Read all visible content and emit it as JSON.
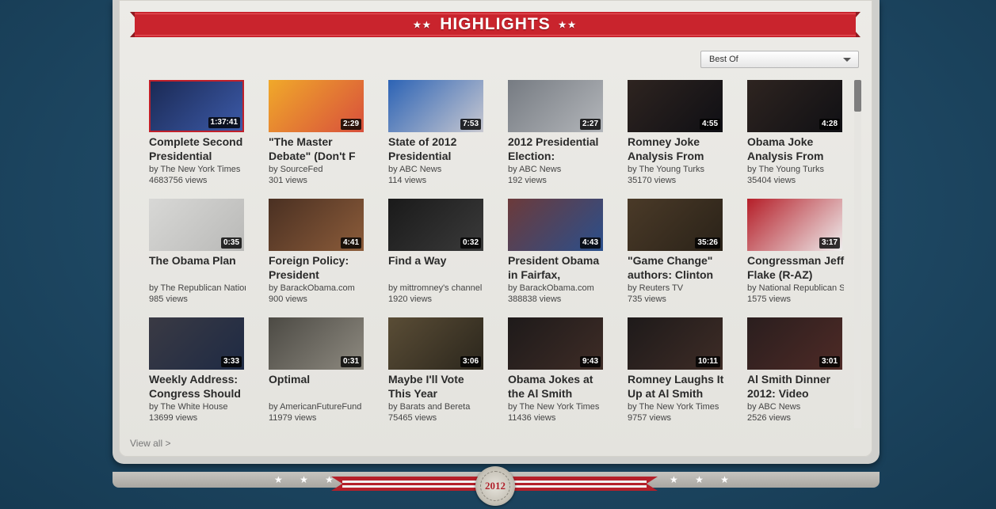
{
  "banner": {
    "title": "HIGHLIGHTS",
    "stars": "★★"
  },
  "filter": {
    "selected": "Best Of"
  },
  "videos": [
    {
      "title": "Complete Second Presidential",
      "duration": "1:37:41",
      "by": "by The New York Times",
      "views": "4683756 views",
      "selected": true
    },
    {
      "title": "\"The Master Debate\" (Don't F",
      "duration": "2:29",
      "by": "by SourceFed",
      "views": "301 views"
    },
    {
      "title": "State of 2012 Presidential",
      "duration": "7:53",
      "by": "by ABC News",
      "views": "114 views"
    },
    {
      "title": "2012 Presidential Election:",
      "duration": "2:27",
      "by": "by ABC News",
      "views": "192 views"
    },
    {
      "title": "Romney Joke Analysis From",
      "duration": "4:55",
      "by": "by The Young Turks",
      "views": "35170 views"
    },
    {
      "title": "Obama Joke Analysis From",
      "duration": "4:28",
      "by": "by The Young Turks",
      "views": "35404 views"
    },
    {
      "title": "The Obama Plan",
      "duration": "0:35",
      "by": "by The Republican Nation",
      "views": "985 views"
    },
    {
      "title": "Foreign Policy: President",
      "duration": "4:41",
      "by": "by BarackObama.com",
      "views": "900 views"
    },
    {
      "title": "Find a Way",
      "duration": "0:32",
      "by": "by mittromney's channel",
      "views": "1920 views"
    },
    {
      "title": "President Obama in Fairfax,",
      "duration": "4:43",
      "by": "by BarackObama.com",
      "views": "388838 views"
    },
    {
      "title": "\"Game Change\" authors: Clinton",
      "duration": "35:26",
      "by": "by Reuters TV",
      "views": "735 views"
    },
    {
      "title": "Congressman Jeff Flake (R-AZ)",
      "duration": "3:17",
      "by": "by National Republican Se",
      "views": "1575 views"
    },
    {
      "title": "Weekly Address: Congress Should",
      "duration": "3:33",
      "by": "by The White House",
      "views": "13699 views"
    },
    {
      "title": "Optimal",
      "duration": "0:31",
      "by": "by AmericanFutureFund",
      "views": "11979 views"
    },
    {
      "title": "Maybe I'll Vote This Year",
      "duration": "3:06",
      "by": "by Barats and Bereta",
      "views": "75465 views"
    },
    {
      "title": "Obama Jokes at the Al Smith",
      "duration": "9:43",
      "by": "by The New York Times",
      "views": "11436 views"
    },
    {
      "title": "Romney Laughs It Up at Al Smith",
      "duration": "10:11",
      "by": "by The New York Times",
      "views": "9757 views"
    },
    {
      "title": "Al Smith Dinner 2012: Video",
      "duration": "3:01",
      "by": "by ABC News",
      "views": "2526 views"
    }
  ],
  "view_all": "View all >",
  "footer": {
    "seal_year": "2012",
    "stars": "★ ★ ★"
  },
  "colors": {
    "banner_red": "#c9242d",
    "selected_border": "#c0202a",
    "background": "#1f4a66"
  }
}
